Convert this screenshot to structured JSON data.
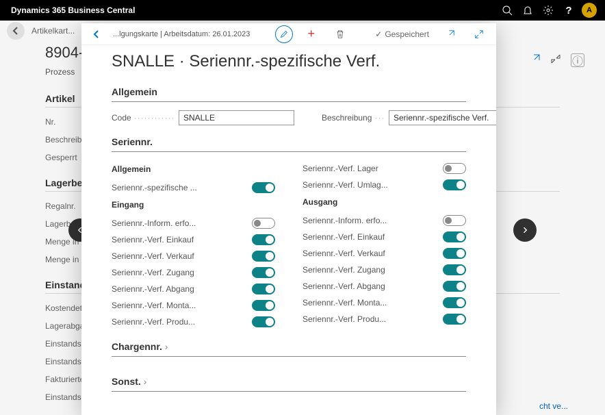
{
  "topbar": {
    "brand": "Dynamics 365 Business Central",
    "avatar": "A"
  },
  "bg": {
    "crumb": "Artikelkart...",
    "title": "8904-",
    "menu": "Prozess",
    "sections": [
      {
        "h": "Artikel",
        "rows": [
          "Nr.",
          "Beschreibun",
          "Gesperrt"
        ]
      },
      {
        "h": "Lagerbes...",
        "rows": [
          "Regalnr.",
          "Lagerbestan",
          "Menge in B",
          "Menge in F"
        ]
      },
      {
        "h": "Einstands...",
        "rows": [
          "Kostendeta",
          "Lagerabgan",
          "Einstandspr",
          "Einstandspr",
          "Fakturierter",
          "Einstandspr"
        ]
      }
    ],
    "link": "cht ve..."
  },
  "modal": {
    "crumb": "...lgungskarte | Arbeitsdatum: 26.01.2023",
    "saved": "Gespeichert",
    "title": "SNALLE · Seriennr.-spezifische Verf.",
    "allgemein": {
      "head": "Allgemein",
      "code_label": "Code",
      "code": "SNALLE",
      "desc_label": "Beschreibung",
      "desc": "Seriennr.-spezifische Verf."
    },
    "seriennr": {
      "head": "Seriennr.",
      "left_sub1": "Allgemein",
      "left1": [
        {
          "l": "Seriennr.-spezifische ...",
          "on": true
        }
      ],
      "left_sub2": "Eingang",
      "left2": [
        {
          "l": "Seriennr.-Inform. erfo...",
          "on": false
        },
        {
          "l": "Seriennr.-Verf. Einkauf",
          "on": true
        },
        {
          "l": "Seriennr.-Verf. Verkauf",
          "on": true
        },
        {
          "l": "Seriennr.-Verf. Zugang",
          "on": true
        },
        {
          "l": "Seriennr.-Verf. Abgang",
          "on": true
        },
        {
          "l": "Seriennr.-Verf. Monta...",
          "on": true
        },
        {
          "l": "Seriennr.-Verf. Produ...",
          "on": true
        }
      ],
      "right1": [
        {
          "l": "Seriennr.-Verf. Lager",
          "on": false
        },
        {
          "l": "Seriennr.-Verf. Umlag...",
          "on": true
        }
      ],
      "right_sub": "Ausgang",
      "right2": [
        {
          "l": "Seriennr.-Inform. erfo...",
          "on": false
        },
        {
          "l": "Seriennr.-Verf. Einkauf",
          "on": true
        },
        {
          "l": "Seriennr.-Verf. Verkauf",
          "on": true
        },
        {
          "l": "Seriennr.-Verf. Zugang",
          "on": true
        },
        {
          "l": "Seriennr.-Verf. Abgang",
          "on": true
        },
        {
          "l": "Seriennr.-Verf. Monta...",
          "on": true
        },
        {
          "l": "Seriennr.-Verf. Produ...",
          "on": true
        }
      ]
    },
    "chargennr": "Chargennr.",
    "sonst": "Sonst."
  }
}
